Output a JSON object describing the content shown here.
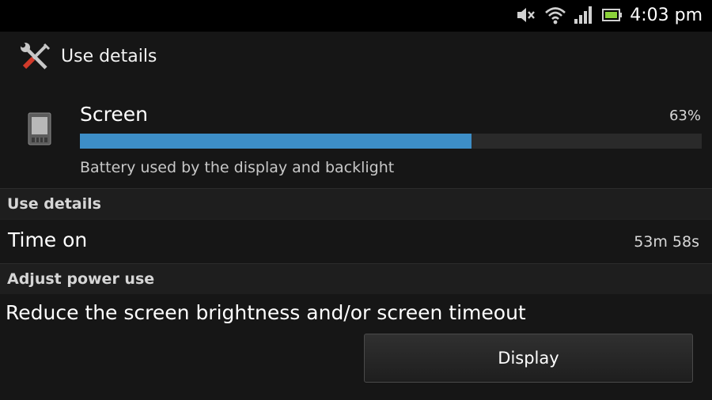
{
  "status_bar": {
    "time": "4:03 pm",
    "icons": [
      "volume-muted-icon",
      "wifi-icon",
      "signal-bars-icon",
      "battery-icon"
    ]
  },
  "header": {
    "title": "Use details",
    "icon": "wrench-screwdriver-icon"
  },
  "usage": {
    "icon": "device-screen-icon",
    "name": "Screen",
    "percent_label": "63%",
    "percent_value": 0.63,
    "bar_color": "#3d8ec7",
    "description": "Battery used by the display and backlight"
  },
  "sections": {
    "use_details": {
      "title": "Use details",
      "time_on_label": "Time on",
      "time_on_value": "53m 58s"
    },
    "adjust_power": {
      "title": "Adjust power use",
      "advice": "Reduce the screen brightness and/or screen timeout",
      "button_label": "Display"
    }
  }
}
